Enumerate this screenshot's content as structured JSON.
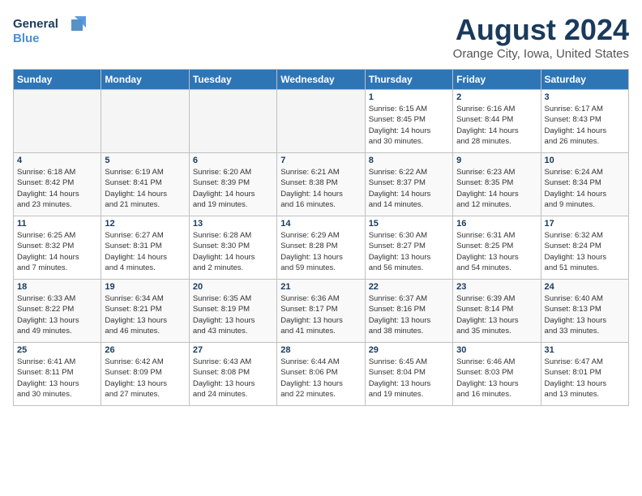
{
  "logo": {
    "line1": "General",
    "line2": "Blue"
  },
  "title": "August 2024",
  "location": "Orange City, Iowa, United States",
  "days_header": [
    "Sunday",
    "Monday",
    "Tuesday",
    "Wednesday",
    "Thursday",
    "Friday",
    "Saturday"
  ],
  "weeks": [
    [
      {
        "day": "",
        "info": ""
      },
      {
        "day": "",
        "info": ""
      },
      {
        "day": "",
        "info": ""
      },
      {
        "day": "",
        "info": ""
      },
      {
        "day": "1",
        "info": "Sunrise: 6:15 AM\nSunset: 8:45 PM\nDaylight: 14 hours\nand 30 minutes."
      },
      {
        "day": "2",
        "info": "Sunrise: 6:16 AM\nSunset: 8:44 PM\nDaylight: 14 hours\nand 28 minutes."
      },
      {
        "day": "3",
        "info": "Sunrise: 6:17 AM\nSunset: 8:43 PM\nDaylight: 14 hours\nand 26 minutes."
      }
    ],
    [
      {
        "day": "4",
        "info": "Sunrise: 6:18 AM\nSunset: 8:42 PM\nDaylight: 14 hours\nand 23 minutes."
      },
      {
        "day": "5",
        "info": "Sunrise: 6:19 AM\nSunset: 8:41 PM\nDaylight: 14 hours\nand 21 minutes."
      },
      {
        "day": "6",
        "info": "Sunrise: 6:20 AM\nSunset: 8:39 PM\nDaylight: 14 hours\nand 19 minutes."
      },
      {
        "day": "7",
        "info": "Sunrise: 6:21 AM\nSunset: 8:38 PM\nDaylight: 14 hours\nand 16 minutes."
      },
      {
        "day": "8",
        "info": "Sunrise: 6:22 AM\nSunset: 8:37 PM\nDaylight: 14 hours\nand 14 minutes."
      },
      {
        "day": "9",
        "info": "Sunrise: 6:23 AM\nSunset: 8:35 PM\nDaylight: 14 hours\nand 12 minutes."
      },
      {
        "day": "10",
        "info": "Sunrise: 6:24 AM\nSunset: 8:34 PM\nDaylight: 14 hours\nand 9 minutes."
      }
    ],
    [
      {
        "day": "11",
        "info": "Sunrise: 6:25 AM\nSunset: 8:32 PM\nDaylight: 14 hours\nand 7 minutes."
      },
      {
        "day": "12",
        "info": "Sunrise: 6:27 AM\nSunset: 8:31 PM\nDaylight: 14 hours\nand 4 minutes."
      },
      {
        "day": "13",
        "info": "Sunrise: 6:28 AM\nSunset: 8:30 PM\nDaylight: 14 hours\nand 2 minutes."
      },
      {
        "day": "14",
        "info": "Sunrise: 6:29 AM\nSunset: 8:28 PM\nDaylight: 13 hours\nand 59 minutes."
      },
      {
        "day": "15",
        "info": "Sunrise: 6:30 AM\nSunset: 8:27 PM\nDaylight: 13 hours\nand 56 minutes."
      },
      {
        "day": "16",
        "info": "Sunrise: 6:31 AM\nSunset: 8:25 PM\nDaylight: 13 hours\nand 54 minutes."
      },
      {
        "day": "17",
        "info": "Sunrise: 6:32 AM\nSunset: 8:24 PM\nDaylight: 13 hours\nand 51 minutes."
      }
    ],
    [
      {
        "day": "18",
        "info": "Sunrise: 6:33 AM\nSunset: 8:22 PM\nDaylight: 13 hours\nand 49 minutes."
      },
      {
        "day": "19",
        "info": "Sunrise: 6:34 AM\nSunset: 8:21 PM\nDaylight: 13 hours\nand 46 minutes."
      },
      {
        "day": "20",
        "info": "Sunrise: 6:35 AM\nSunset: 8:19 PM\nDaylight: 13 hours\nand 43 minutes."
      },
      {
        "day": "21",
        "info": "Sunrise: 6:36 AM\nSunset: 8:17 PM\nDaylight: 13 hours\nand 41 minutes."
      },
      {
        "day": "22",
        "info": "Sunrise: 6:37 AM\nSunset: 8:16 PM\nDaylight: 13 hours\nand 38 minutes."
      },
      {
        "day": "23",
        "info": "Sunrise: 6:39 AM\nSunset: 8:14 PM\nDaylight: 13 hours\nand 35 minutes."
      },
      {
        "day": "24",
        "info": "Sunrise: 6:40 AM\nSunset: 8:13 PM\nDaylight: 13 hours\nand 33 minutes."
      }
    ],
    [
      {
        "day": "25",
        "info": "Sunrise: 6:41 AM\nSunset: 8:11 PM\nDaylight: 13 hours\nand 30 minutes."
      },
      {
        "day": "26",
        "info": "Sunrise: 6:42 AM\nSunset: 8:09 PM\nDaylight: 13 hours\nand 27 minutes."
      },
      {
        "day": "27",
        "info": "Sunrise: 6:43 AM\nSunset: 8:08 PM\nDaylight: 13 hours\nand 24 minutes."
      },
      {
        "day": "28",
        "info": "Sunrise: 6:44 AM\nSunset: 8:06 PM\nDaylight: 13 hours\nand 22 minutes."
      },
      {
        "day": "29",
        "info": "Sunrise: 6:45 AM\nSunset: 8:04 PM\nDaylight: 13 hours\nand 19 minutes."
      },
      {
        "day": "30",
        "info": "Sunrise: 6:46 AM\nSunset: 8:03 PM\nDaylight: 13 hours\nand 16 minutes."
      },
      {
        "day": "31",
        "info": "Sunrise: 6:47 AM\nSunset: 8:01 PM\nDaylight: 13 hours\nand 13 minutes."
      }
    ]
  ]
}
